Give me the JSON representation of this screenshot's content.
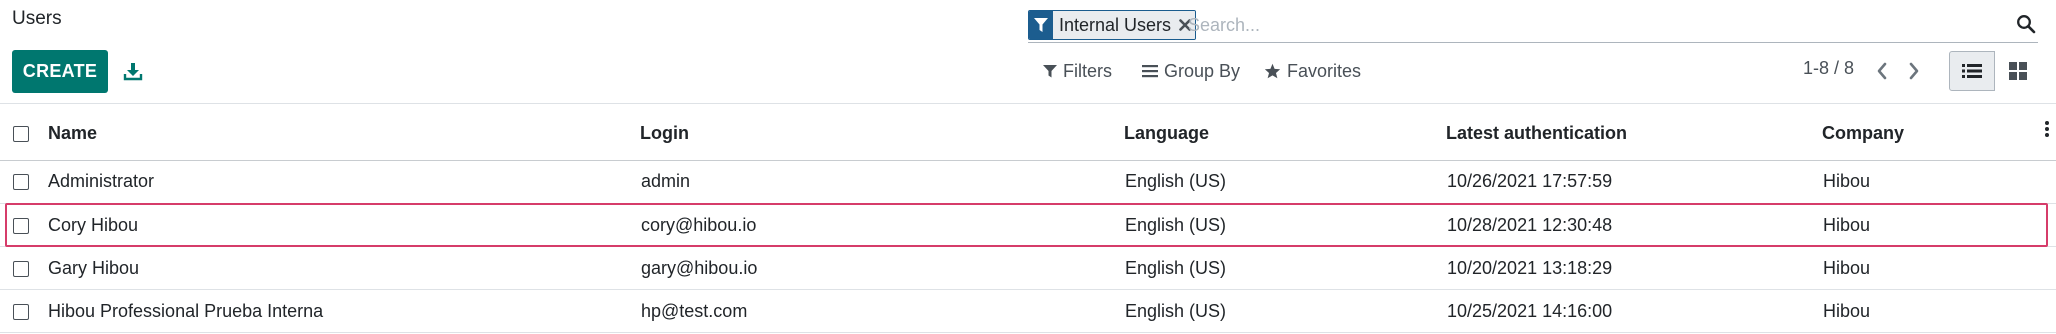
{
  "breadcrumb": {
    "title": "Users"
  },
  "toolbar": {
    "create_label": "CREATE",
    "download_icon": "download-icon"
  },
  "search": {
    "facet_label": "Internal Users",
    "facet_icon": "filter-icon",
    "placeholder": "Search...",
    "value": ""
  },
  "search_options": {
    "filters_label": "Filters",
    "group_by_label": "Group By",
    "favorites_label": "Favorites"
  },
  "pager": {
    "value": "1-8 / 8"
  },
  "views": {
    "active": "list",
    "options": [
      "list",
      "kanban"
    ]
  },
  "colors": {
    "primary": "#00776f",
    "facet": "#1c5d8f",
    "highlight": "#d63c6a"
  },
  "table": {
    "columns": [
      "Name",
      "Login",
      "Language",
      "Latest authentication",
      "Company"
    ],
    "rows": [
      [
        "Administrator",
        "admin",
        "English (US)",
        "10/26/2021 17:57:59",
        "Hibou"
      ],
      [
        "Cory Hibou",
        "cory@hibou.io",
        "English (US)",
        "10/28/2021 12:30:48",
        "Hibou"
      ],
      [
        "Gary Hibou",
        "gary@hibou.io",
        "English (US)",
        "10/20/2021 13:18:29",
        "Hibou"
      ],
      [
        "Hibou Professional Prueba Interna",
        "hp@test.com",
        "English (US)",
        "10/25/2021 14:16:00",
        "Hibou"
      ]
    ],
    "highlighted_row": 1
  }
}
